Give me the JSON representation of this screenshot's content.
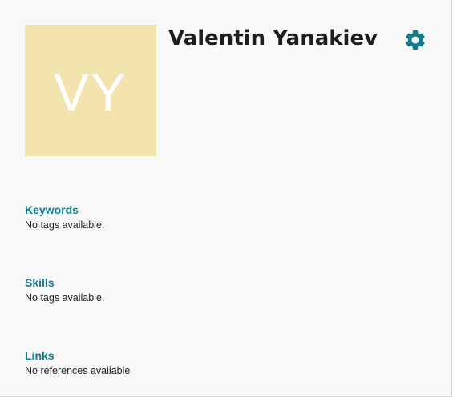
{
  "profile": {
    "initials": "VY",
    "name": "Valentin Yanakiev",
    "avatar_color": "#f3e3ae",
    "settings_icon": "gear-icon"
  },
  "colors": {
    "accent": "#0f7d8c",
    "name_text": "#1d1d24"
  },
  "sections": {
    "keywords": {
      "title": "Keywords",
      "body": "No tags available."
    },
    "skills": {
      "title": "Skills",
      "body": "No tags available."
    },
    "links": {
      "title": "Links",
      "body": "No references available"
    }
  }
}
